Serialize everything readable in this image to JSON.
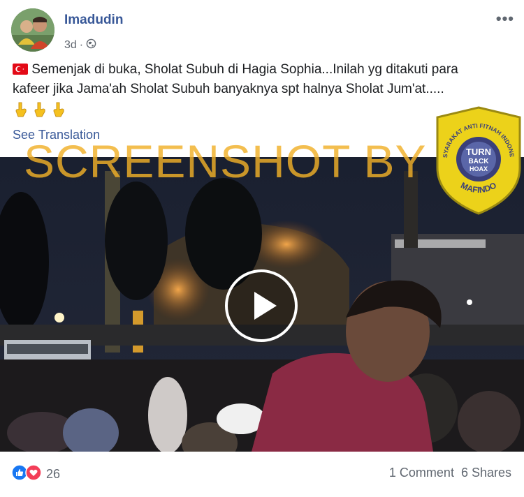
{
  "post": {
    "author": "Imadudin",
    "time": "3d",
    "privacy_icon": "globe-icon",
    "text_line1": " Semenjak di buka, Sholat Subuh di Hagia Sophia...Inilah yg ditakuti para",
    "text_line2": "kafeer jika Jama'ah Sholat Subuh banyaknya spt halnya Sholat Jum'at.....",
    "flag_icon": "turkey-flag-icon",
    "emoji_icons": [
      "pointing-down-icon",
      "pointing-down-icon",
      "pointing-down-icon"
    ],
    "see_translation": "See Translation"
  },
  "watermark": {
    "text": "SCREENSHOT BY",
    "badge_top_text": "MASYARAKAT ANTI FITNAH INDONESIA",
    "badge_center_line1": "TURN",
    "badge_center_line2": "BACK",
    "badge_center_line3": "HOAX",
    "badge_bottom_text": "MAFINDO"
  },
  "video": {
    "play_icon": "play-icon"
  },
  "footer": {
    "reaction_icons": [
      "like-icon",
      "love-icon"
    ],
    "reaction_count": "26",
    "comments": "1 Comment",
    "shares": "6 Shares"
  },
  "colors": {
    "link_blue": "#385898",
    "badge_yellow": "#f0d000",
    "badge_navy": "#3a3f7a",
    "watermark_orange": "#f0b028"
  }
}
